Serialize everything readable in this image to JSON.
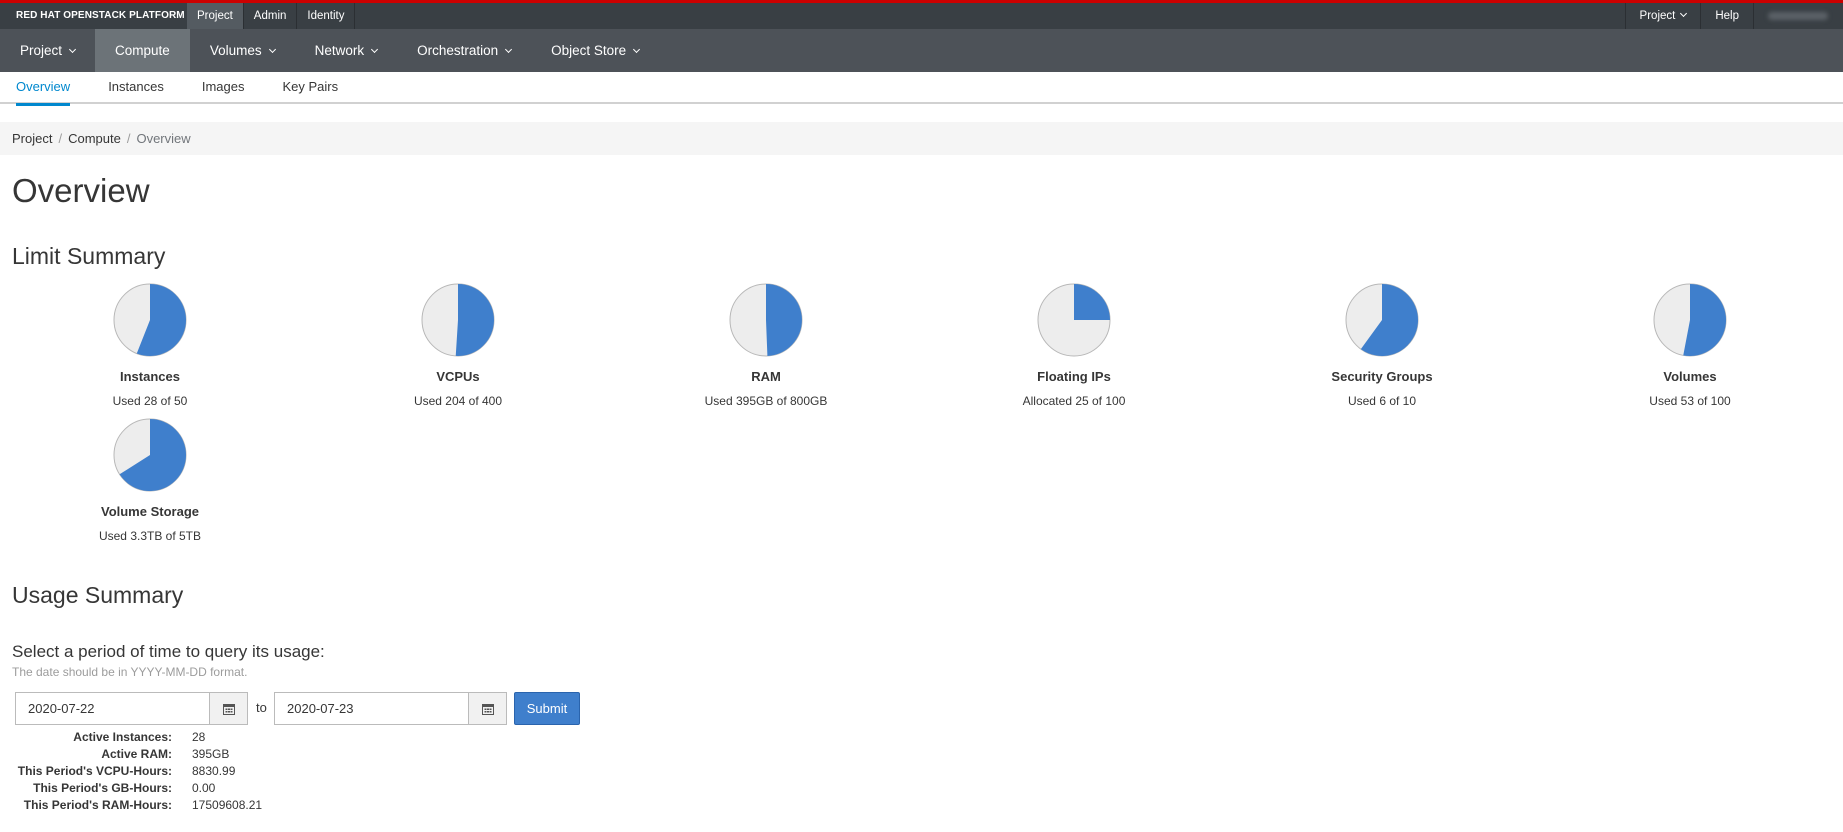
{
  "masthead": {
    "brand": "RED HAT OPENSTACK PLATFORM",
    "tabs": [
      {
        "label": "Project",
        "active": true
      },
      {
        "label": "Admin",
        "active": false
      },
      {
        "label": "Identity",
        "active": false
      }
    ],
    "project_menu": "Project",
    "help": "Help"
  },
  "nav": {
    "items": [
      {
        "label": "Project",
        "active": false
      },
      {
        "label": "Compute",
        "active": true
      },
      {
        "label": "Volumes",
        "active": false
      },
      {
        "label": "Network",
        "active": false
      },
      {
        "label": "Orchestration",
        "active": false
      },
      {
        "label": "Object Store",
        "active": false
      }
    ]
  },
  "subnav": {
    "items": [
      {
        "label": "Overview",
        "active": true
      },
      {
        "label": "Instances",
        "active": false
      },
      {
        "label": "Images",
        "active": false
      },
      {
        "label": "Key Pairs",
        "active": false
      }
    ]
  },
  "breadcrumb": [
    "Project",
    "Compute",
    "Overview"
  ],
  "page_title": "Overview",
  "limit_summary": {
    "heading": "Limit Summary",
    "pies": [
      {
        "label": "Instances",
        "used_text": "Used 28 of 50",
        "used": 28,
        "total": 50
      },
      {
        "label": "VCPUs",
        "used_text": "Used 204 of 400",
        "used": 204,
        "total": 400
      },
      {
        "label": "RAM",
        "used_text": "Used 395GB of 800GB",
        "used": 395,
        "total": 800
      },
      {
        "label": "Floating IPs",
        "used_text": "Allocated 25 of 100",
        "used": 25,
        "total": 100
      },
      {
        "label": "Security Groups",
        "used_text": "Used 6 of 10",
        "used": 6,
        "total": 10
      },
      {
        "label": "Volumes",
        "used_text": "Used 53 of 100",
        "used": 53,
        "total": 100
      },
      {
        "label": "Volume Storage",
        "used_text": "Used 3.3TB of 5TB",
        "used": 3.3,
        "total": 5
      }
    ],
    "colors": {
      "used": "#3f7fcc",
      "free": "#ededed",
      "border": "#b8b8b8"
    }
  },
  "usage_summary": {
    "heading": "Usage Summary",
    "period_label": "Select a period of time to query its usage:",
    "help": "The date should be in YYYY-MM-DD format.",
    "start_date": "2020-07-22",
    "to_label": "to",
    "end_date": "2020-07-23",
    "submit": "Submit",
    "stats": [
      {
        "key": "Active Instances:",
        "value": "28"
      },
      {
        "key": "Active RAM:",
        "value": "395GB"
      },
      {
        "key": "This Period's VCPU-Hours:",
        "value": "8830.99"
      },
      {
        "key": "This Period's GB-Hours:",
        "value": "0.00"
      },
      {
        "key": "This Period's RAM-Hours:",
        "value": "17509608.21"
      }
    ]
  }
}
